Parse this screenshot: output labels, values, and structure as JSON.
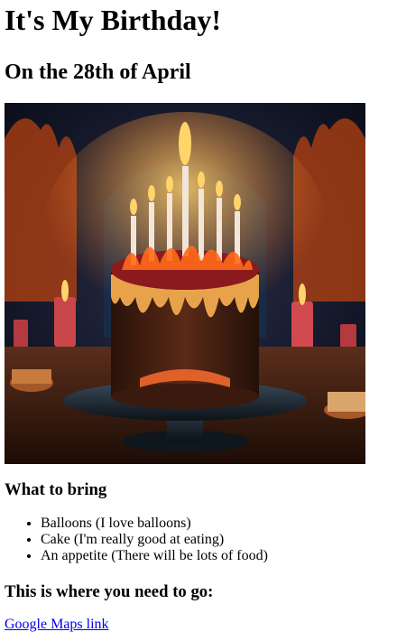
{
  "heading": "It's My Birthday!",
  "date": "On the 28th of April",
  "bring": {
    "title": "What to bring",
    "items": [
      "Balloons (I love balloons)",
      "Cake (I'm really good at eating)",
      "An appetite (There will be lots of food)"
    ]
  },
  "location": {
    "title": "This is where you need to go:",
    "link_label": "Google Maps link"
  },
  "colors": {
    "link": "#0000ee",
    "text": "#000000"
  }
}
